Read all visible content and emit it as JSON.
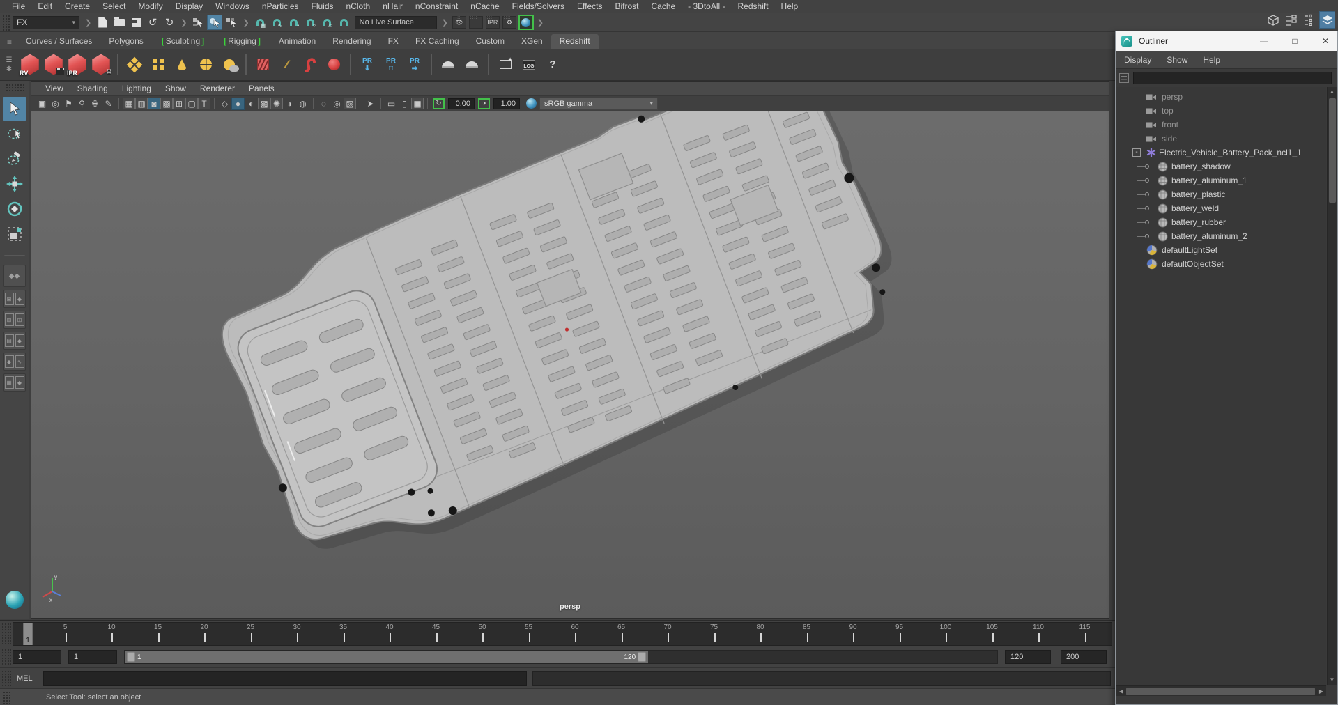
{
  "menu_bar": {
    "items": [
      "File",
      "Edit",
      "Create",
      "Select",
      "Modify",
      "Display",
      "Windows",
      "nParticles",
      "Fluids",
      "nCloth",
      "nHair",
      "nConstraint",
      "nCache",
      "Fields/Solvers",
      "Effects",
      "Bifrost",
      "Cache",
      "- 3DtoAll -",
      "Redshift",
      "Help"
    ]
  },
  "status_line": {
    "mode": "FX",
    "live_surface": "No Live Surface"
  },
  "shelf": {
    "tabs": [
      {
        "label": "Curves / Surfaces"
      },
      {
        "label": "Polygons"
      },
      {
        "label": "Sculpting",
        "bracketed": true
      },
      {
        "label": "Rigging",
        "bracketed": true
      },
      {
        "label": "Animation"
      },
      {
        "label": "Rendering"
      },
      {
        "label": "FX"
      },
      {
        "label": "FX Caching"
      },
      {
        "label": "Custom"
      },
      {
        "label": "XGen"
      },
      {
        "label": "Redshift",
        "active": true
      }
    ],
    "items": [
      {
        "kind": "gem",
        "label": "RV",
        "name": "redshift-renderview"
      },
      {
        "kind": "gem",
        "badge": "film",
        "name": "redshift-render"
      },
      {
        "kind": "gem",
        "label": "IPR",
        "name": "redshift-ipr"
      },
      {
        "kind": "gem",
        "badge": "gear",
        "name": "redshift-settings"
      },
      {
        "kind": "sep"
      },
      {
        "kind": "y-lattice",
        "name": "lattice"
      },
      {
        "kind": "y-grid",
        "name": "plane"
      },
      {
        "kind": "y-cone",
        "name": "cone-light"
      },
      {
        "kind": "y-sphere",
        "name": "sphere-light"
      },
      {
        "kind": "y-env",
        "name": "environment"
      },
      {
        "kind": "sep"
      },
      {
        "kind": "r-cube",
        "name": "volume"
      },
      {
        "kind": "strands",
        "label": "///",
        "name": "hair-strands"
      },
      {
        "kind": "r-hose",
        "name": "curve"
      },
      {
        "kind": "r-sphere",
        "name": "proxy-sphere"
      },
      {
        "kind": "sep"
      },
      {
        "kind": "pr-down",
        "label": "PR",
        "name": "proxy-export"
      },
      {
        "kind": "pr-box",
        "label": "PR",
        "name": "proxy-create"
      },
      {
        "kind": "pr-arrow",
        "label": "PR",
        "name": "proxy-import"
      },
      {
        "kind": "sep"
      },
      {
        "kind": "dome",
        "name": "ies-light"
      },
      {
        "kind": "dome",
        "name": "dome-light"
      },
      {
        "kind": "sep"
      },
      {
        "kind": "win",
        "name": "feedback-window"
      },
      {
        "kind": "log",
        "label": "LOG",
        "name": "log-window"
      },
      {
        "kind": "help",
        "label": "?",
        "name": "help"
      }
    ]
  },
  "panel": {
    "menus": [
      "View",
      "Shading",
      "Lighting",
      "Show",
      "Renderer",
      "Panels"
    ],
    "toolbar": {
      "exposure": "0.00",
      "gamma": "1.00",
      "color_space": "sRGB gamma"
    },
    "camera_label": "persp"
  },
  "outliner": {
    "title": "Outliner",
    "menus": [
      "Display",
      "Show",
      "Help"
    ],
    "rows": [
      {
        "label": "persp",
        "icon": "camera",
        "grayed": true
      },
      {
        "label": "top",
        "icon": "camera",
        "grayed": true
      },
      {
        "label": "front",
        "icon": "camera",
        "grayed": true
      },
      {
        "label": "side",
        "icon": "camera",
        "grayed": true
      },
      {
        "label": "Electric_Vehicle_Battery_Pack_ncl1_1",
        "icon": "asterisk",
        "expander": "-"
      },
      {
        "label": "battery_shadow",
        "icon": "mesh",
        "child": true
      },
      {
        "label": "battery_aluminum_1",
        "icon": "mesh",
        "child": true
      },
      {
        "label": "battery_plastic",
        "icon": "mesh",
        "child": true
      },
      {
        "label": "battery_weld",
        "icon": "mesh",
        "child": true
      },
      {
        "label": "battery_rubber",
        "icon": "mesh",
        "child": true
      },
      {
        "label": "battery_aluminum_2",
        "icon": "mesh",
        "child": true
      },
      {
        "label": "defaultLightSet",
        "icon": "set"
      },
      {
        "label": "defaultObjectSet",
        "icon": "set"
      }
    ]
  },
  "time_slider": {
    "current_frame": "1",
    "tick_labels": [
      5,
      10,
      15,
      20,
      25,
      30,
      35,
      40,
      45,
      50,
      55,
      60,
      65,
      70,
      75,
      80,
      85,
      90,
      95,
      100,
      105,
      110,
      115
    ]
  },
  "range_slider": {
    "start_field": "1",
    "anim_start_field": "1",
    "bar_start": "1",
    "bar_end": "120",
    "end_field": "120",
    "anim_end_field": "200"
  },
  "command_line": {
    "label": "MEL"
  },
  "help_line": {
    "text": "Select Tool: select an object"
  },
  "colors": {
    "highlight": "#5285a6",
    "bracket_green": "#3bd43b",
    "gem_red": "#e25454",
    "shelf_yellow": "#efc24e",
    "snap_teal": "#56b7ad",
    "render_green": "#43c04a"
  }
}
